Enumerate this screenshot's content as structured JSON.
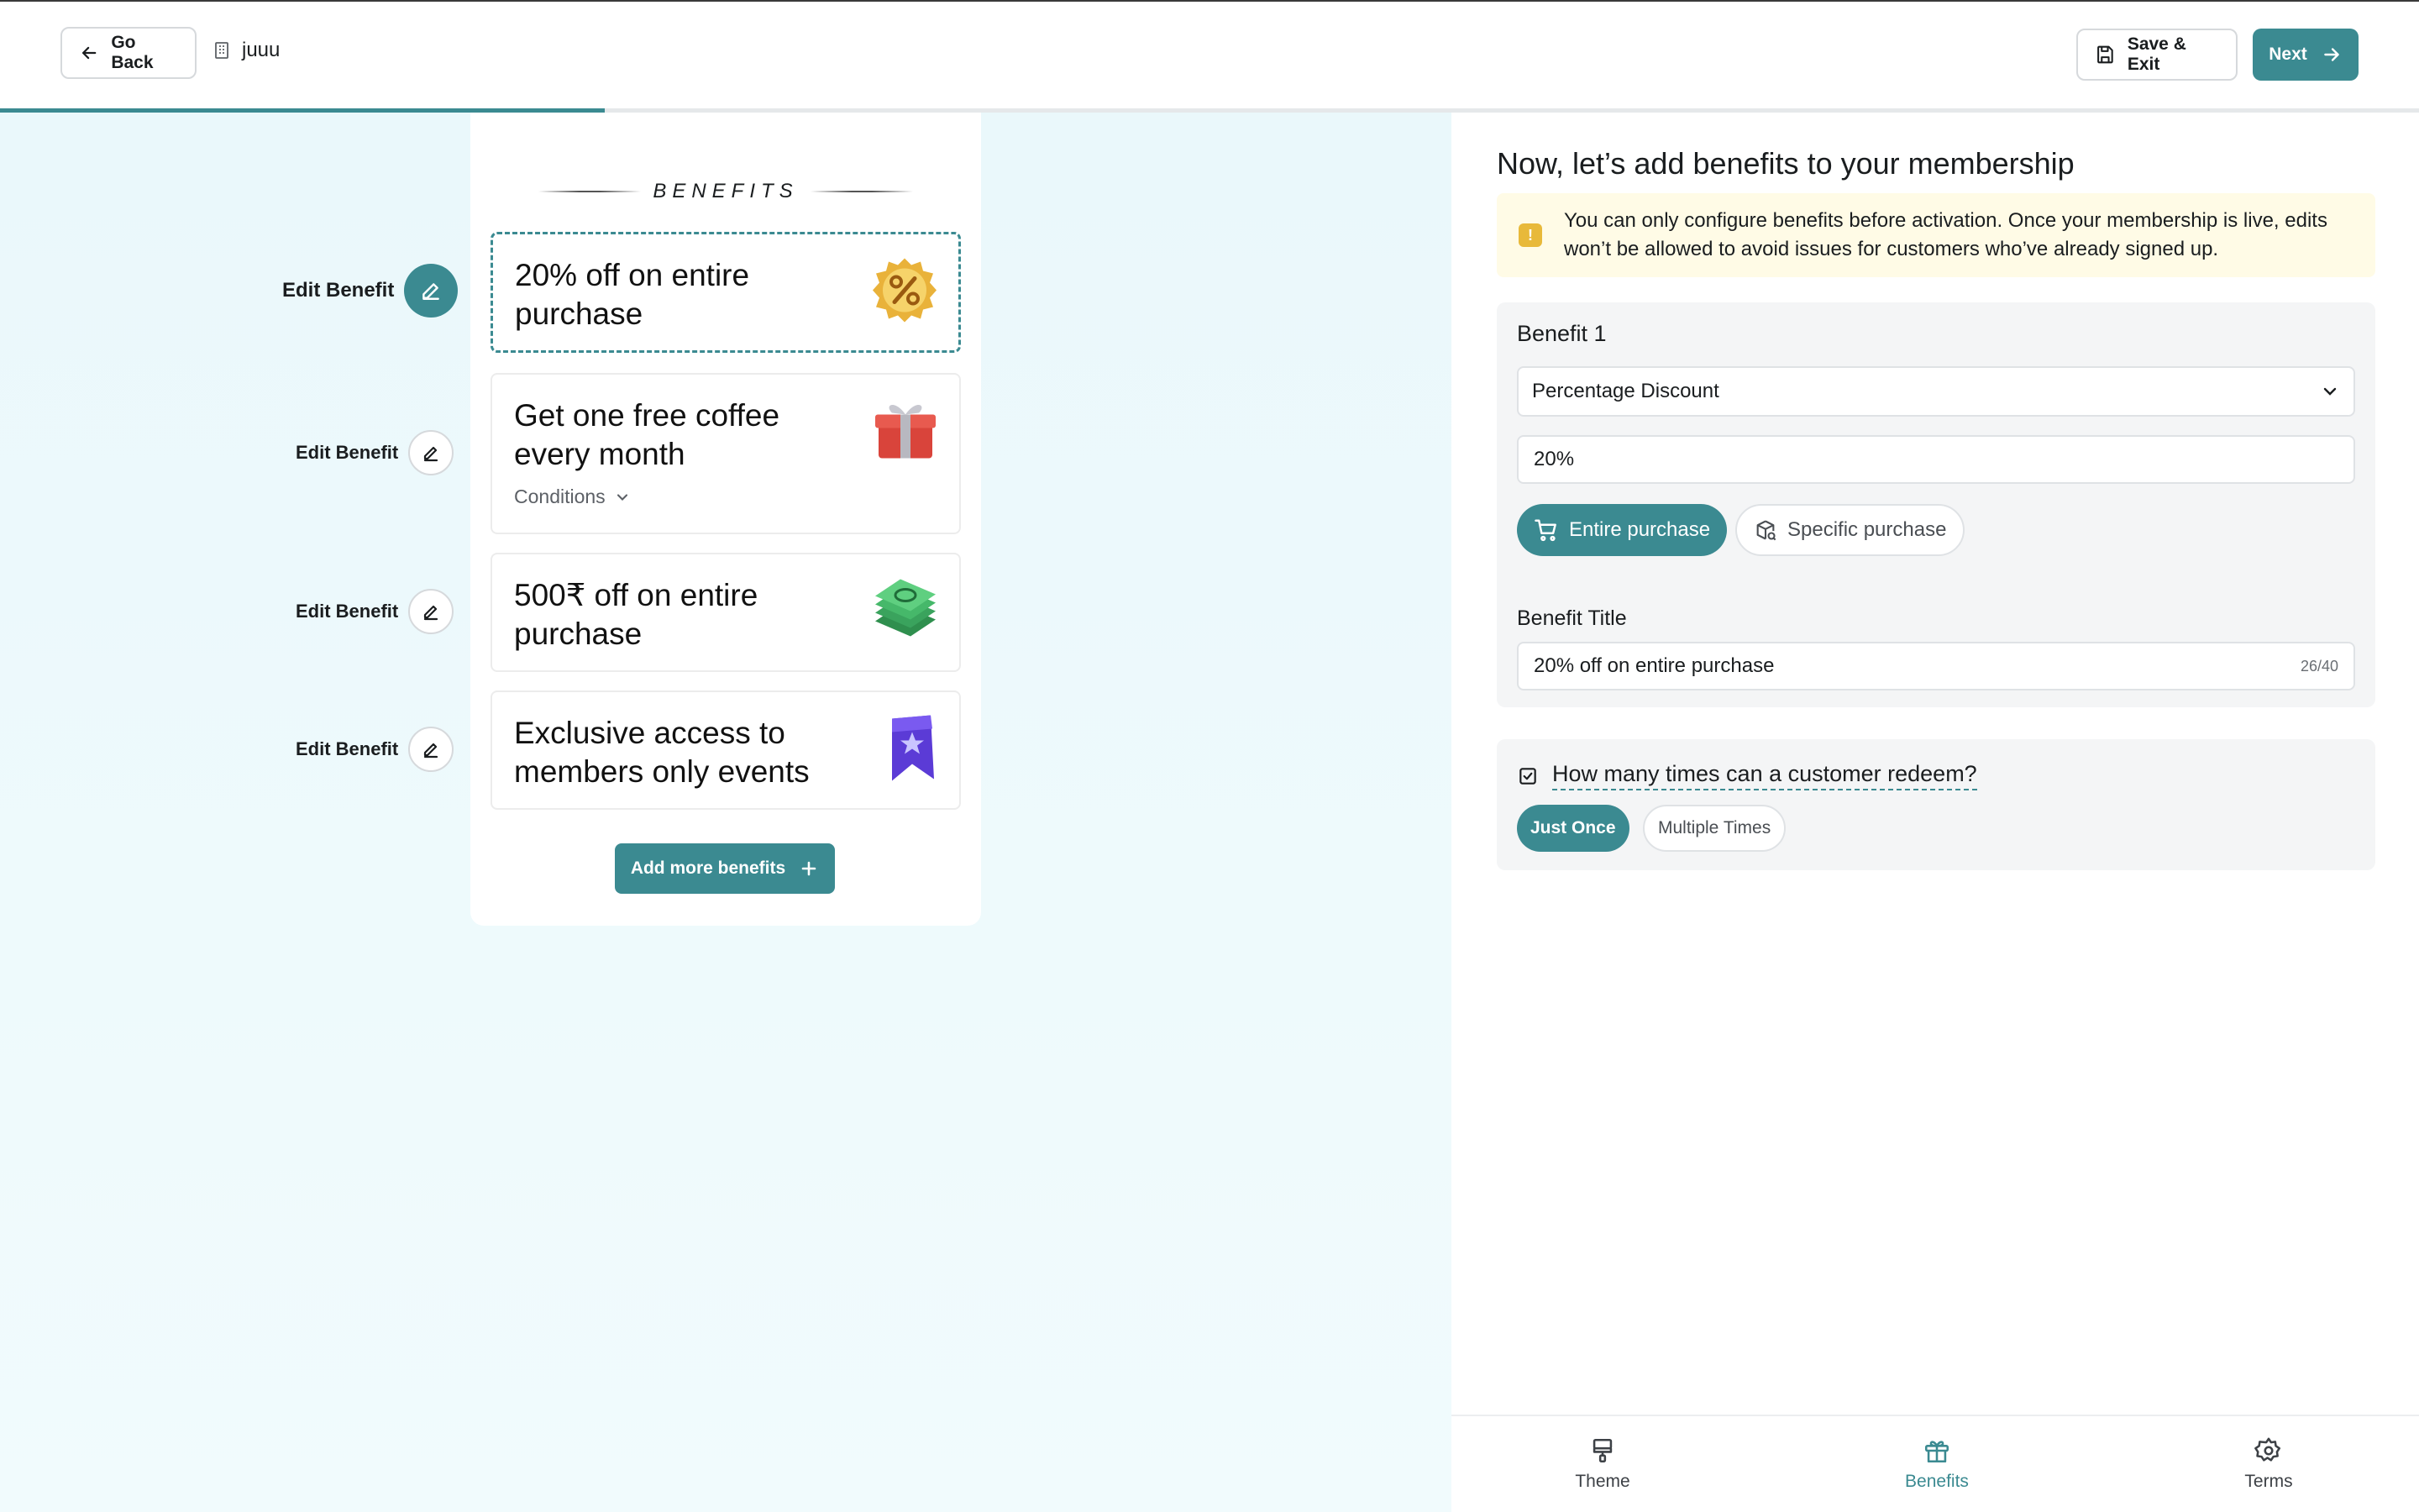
{
  "header": {
    "go_back_label": "Go Back",
    "org_name": "juuu",
    "save_exit_label": "Save & Exit",
    "next_label": "Next",
    "progress_fraction": 0.25
  },
  "preview": {
    "heading": "BENEFITS",
    "edit_label": "Edit Benefit",
    "benefits": [
      {
        "title": "20% off on entire purchase",
        "icon": "percent-badge-icon",
        "active": true
      },
      {
        "title": "Get one free coffee every month",
        "icon": "gift-box-icon",
        "conditions_label": "Conditions"
      },
      {
        "title": "500₹ off on entire purchase",
        "icon": "money-stack-icon"
      },
      {
        "title": "Exclusive access to members only events",
        "icon": "star-bookmark-icon"
      }
    ],
    "add_more_label": "Add more benefits"
  },
  "form": {
    "title": "Now, let’s add benefits to your membership",
    "warning": "You can only configure benefits before activation. Once your membership is live, edits won’t be allowed to avoid issues for customers who’ve already signed up.",
    "benefit_label": "Benefit 1",
    "type_value": "Percentage Discount",
    "amount_value": "20%",
    "scope_options": [
      "Entire purchase",
      "Specific purchase"
    ],
    "scope_selected": "Entire purchase",
    "benefit_title_label": "Benefit Title",
    "benefit_title_value": "20% off on entire purchase",
    "benefit_title_counter": "26/40",
    "redeem_question": "How many times can a customer redeem?",
    "redeem_options": [
      "Just Once",
      "Multiple Times"
    ],
    "redeem_selected": "Just Once"
  },
  "bottom_nav": {
    "items": [
      "Theme",
      "Benefits",
      "Terms"
    ],
    "active": "Benefits"
  },
  "colors": {
    "accent": "#3b8a91",
    "warning_bg": "#fffbe6",
    "warning_icon": "#e8b93a",
    "preview_bg": "#eaf8fb"
  }
}
